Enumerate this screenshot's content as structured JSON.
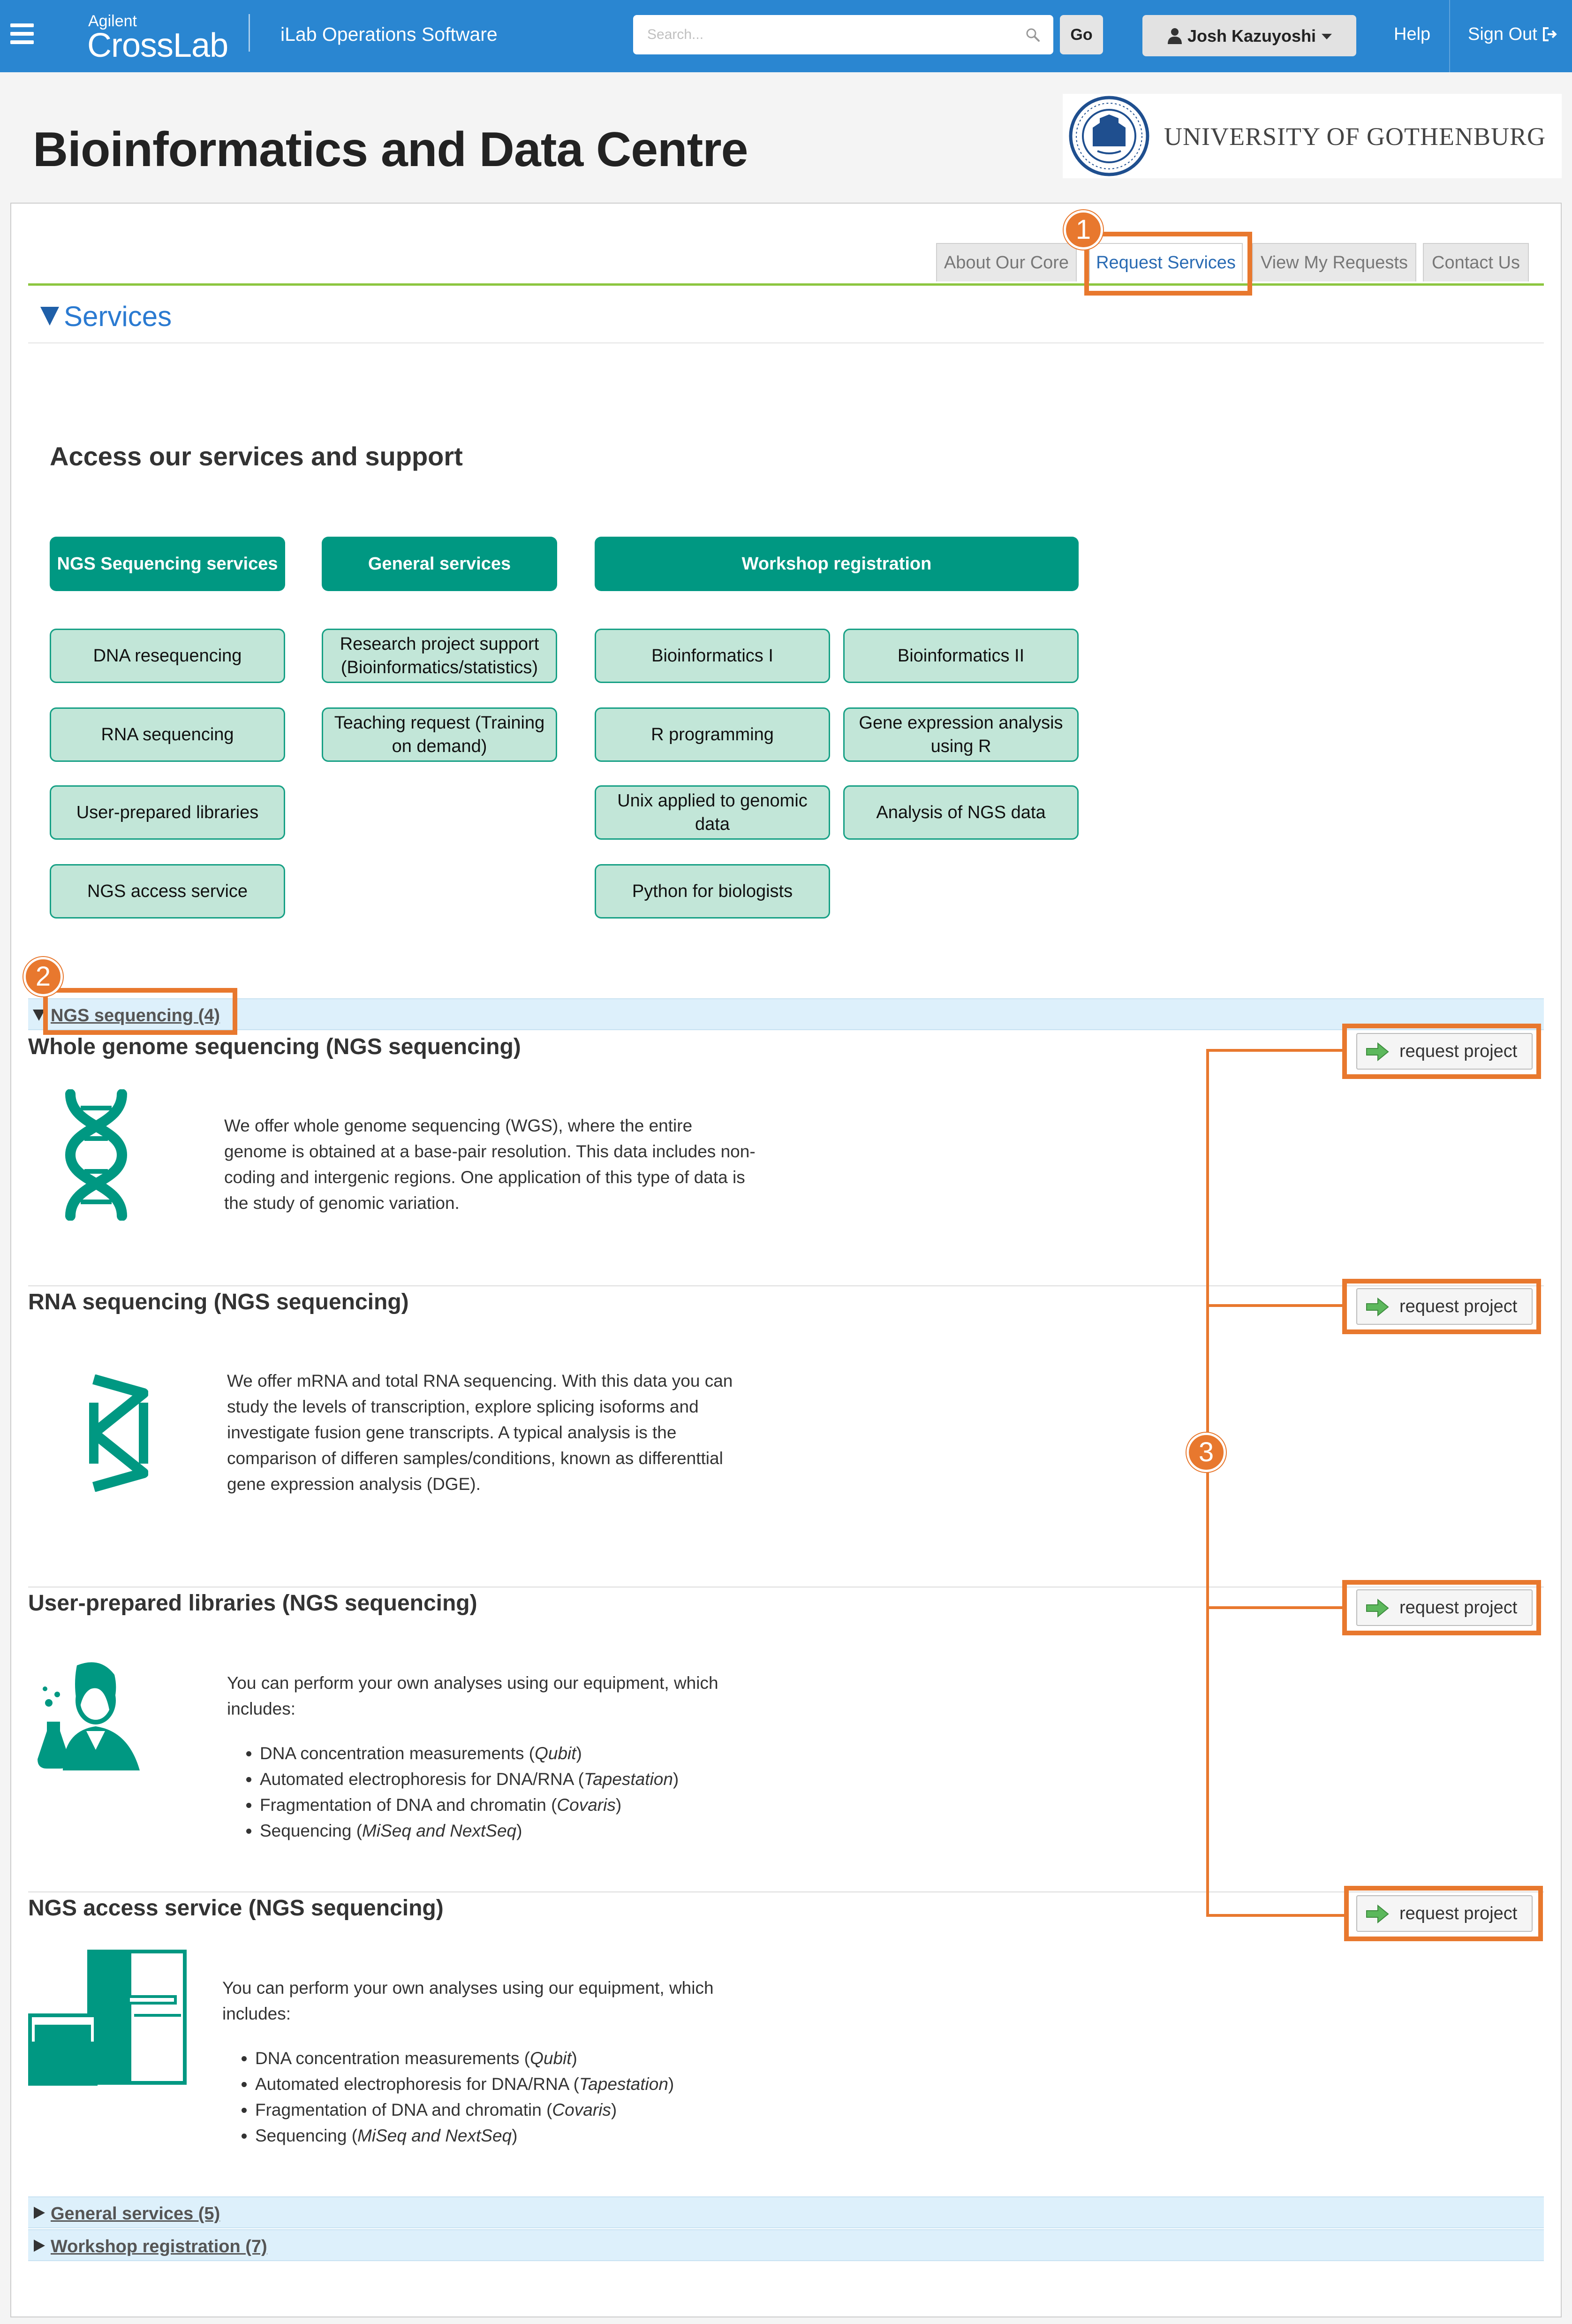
{
  "topbar": {
    "brand_small": "Agilent",
    "brand_big": "CrossLab",
    "app_name": "iLab Operations Software",
    "search_placeholder": "Search...",
    "go_label": "Go",
    "user_name": "Josh Kazuyoshi",
    "help_label": "Help",
    "signout_label": "Sign Out"
  },
  "header": {
    "title": "Bioinformatics and Data Centre",
    "university_name": "UNIVERSITY OF GOTHENBURG"
  },
  "tabs": [
    {
      "label": "About Our Core"
    },
    {
      "label": "Request Services"
    },
    {
      "label": "View My Requests"
    },
    {
      "label": "Contact Us"
    }
  ],
  "services": {
    "section_title": "Services",
    "access_title": "Access our services and support",
    "headers": {
      "ngs": "NGS Sequencing services",
      "general": "General services",
      "workshop": "Workshop registration"
    },
    "ngs_buttons": [
      "DNA resequencing",
      "RNA sequencing",
      "User-prepared libraries",
      "NGS access service"
    ],
    "general_buttons": [
      "Research project support (Bioinformatics/statistics)",
      "Teaching request (Training on demand)"
    ],
    "workshop_buttons": [
      "Bioinformatics I",
      "Bioinformatics II",
      "R programming",
      "Gene expression analysis using R",
      "Unix applied to genomic data",
      "Analysis of NGS data",
      "Python for biologists"
    ]
  },
  "categories": {
    "ngs": "NGS sequencing (4)",
    "general": "General services (5)",
    "workshop": "Workshop registration (7)"
  },
  "items": [
    {
      "title": "Whole genome sequencing (NGS sequencing)",
      "desc": "We offer whole genome sequencing (WGS), where the entire genome is obtained at a base-pair resolution. This data includes non-coding and intergenic regions. One application of this type of data is the study of genomic variation.",
      "button": "request project"
    },
    {
      "title": "RNA sequencing (NGS sequencing)",
      "desc": "We offer mRNA and total RNA sequencing. With this data you can study the levels of transcription, explore splicing isoforms and investigate fusion gene transcripts. A typical analysis is the comparison of differen samples/conditions, known as differenttial gene expression analysis (DGE).",
      "button": "request project"
    },
    {
      "title": "User-prepared libraries (NGS sequencing)",
      "desc": "You can perform your own analyses using our equipment, which includes:",
      "bullets": [
        {
          "text": "DNA concentration measurements (",
          "em": "Qubit",
          "end": ")"
        },
        {
          "text": "Automated electrophoresis for DNA/RNA (",
          "em": "Tapestation",
          "end": ")"
        },
        {
          "text": "Fragmentation of DNA and chromatin (",
          "em": "Covaris",
          "end": ")"
        },
        {
          "text": "Sequencing (",
          "em": "MiSeq and NextSeq",
          "end": ")"
        }
      ],
      "button": "request project"
    },
    {
      "title": "NGS access service (NGS sequencing)",
      "desc": "You can perform your own analyses using our equipment, which includes:",
      "bullets": [
        {
          "text": "DNA concentration measurements (",
          "em": "Qubit",
          "end": ")"
        },
        {
          "text": "Automated electrophoresis for DNA/RNA (",
          "em": "Tapestation",
          "end": ")"
        },
        {
          "text": "Fragmentation of DNA and chromatin (",
          "em": "Covaris",
          "end": ")"
        },
        {
          "text": "Sequencing (",
          "em": "MiSeq and NextSeq",
          "end": ")"
        }
      ],
      "button": "request project"
    }
  ],
  "annotations": [
    "1",
    "2",
    "3"
  ],
  "colors": {
    "topbar": "#2a86d1",
    "accent_green": "#009882",
    "light_green": "#c2e6d8",
    "annotation": "#e8782e",
    "category_bar": "#ddf0fb"
  }
}
